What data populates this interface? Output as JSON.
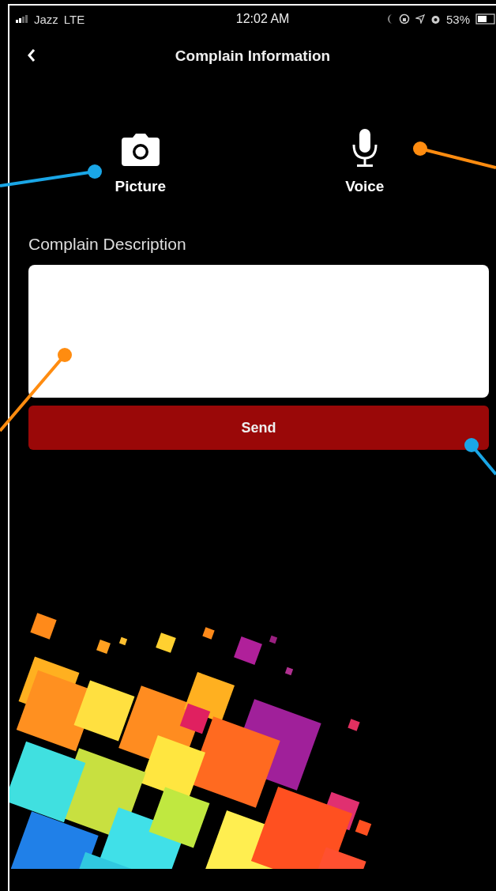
{
  "status_bar": {
    "carrier": "Jazz",
    "network": "LTE",
    "time": "12:02 AM",
    "battery": "53%"
  },
  "nav": {
    "title": "Complain Information"
  },
  "media_options": [
    {
      "kind": "camera",
      "label": "Picture"
    },
    {
      "kind": "microphone",
      "label": "Voice"
    }
  ],
  "description": {
    "label": "Complain Description"
  },
  "send_button": {
    "label": "Send"
  }
}
